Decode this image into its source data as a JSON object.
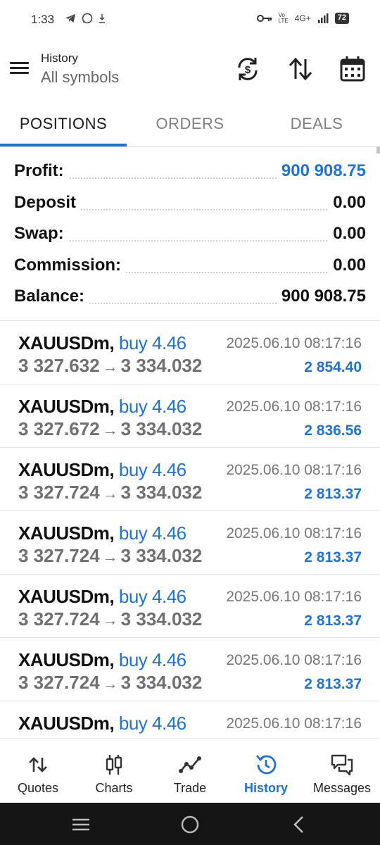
{
  "status": {
    "time": "1:33",
    "network": "4G+",
    "battery": "72"
  },
  "header": {
    "title": "History",
    "subtitle": "All symbols"
  },
  "tabs": [
    {
      "label": "POSITIONS",
      "active": true
    },
    {
      "label": "ORDERS",
      "active": false
    },
    {
      "label": "DEALS",
      "active": false
    }
  ],
  "summary": {
    "profit": {
      "label": "Profit:",
      "value": "900 908.75"
    },
    "deposit": {
      "label": "Deposit",
      "value": "0.00"
    },
    "swap": {
      "label": "Swap:",
      "value": "0.00"
    },
    "commission": {
      "label": "Commission:",
      "value": "0.00"
    },
    "balance": {
      "label": "Balance:",
      "value": "900 908.75"
    }
  },
  "deals": [
    {
      "symbol": "XAUUSDm,",
      "action": "buy 4.46",
      "time": "2025.06.10 08:17:16",
      "open": "3 327.632",
      "arrow": "→",
      "close": "3 334.032",
      "profit": "2 854.40"
    },
    {
      "symbol": "XAUUSDm,",
      "action": "buy 4.46",
      "time": "2025.06.10 08:17:16",
      "open": "3 327.672",
      "arrow": "→",
      "close": "3 334.032",
      "profit": "2 836.56"
    },
    {
      "symbol": "XAUUSDm,",
      "action": "buy 4.46",
      "time": "2025.06.10 08:17:16",
      "open": "3 327.724",
      "arrow": "→",
      "close": "3 334.032",
      "profit": "2 813.37"
    },
    {
      "symbol": "XAUUSDm,",
      "action": "buy 4.46",
      "time": "2025.06.10 08:17:16",
      "open": "3 327.724",
      "arrow": "→",
      "close": "3 334.032",
      "profit": "2 813.37"
    },
    {
      "symbol": "XAUUSDm,",
      "action": "buy 4.46",
      "time": "2025.06.10 08:17:16",
      "open": "3 327.724",
      "arrow": "→",
      "close": "3 334.032",
      "profit": "2 813.37"
    },
    {
      "symbol": "XAUUSDm,",
      "action": "buy 4.46",
      "time": "2025.06.10 08:17:16",
      "open": "3 327.724",
      "arrow": "→",
      "close": "3 334.032",
      "profit": "2 813.37"
    },
    {
      "symbol": "XAUUSDm,",
      "action": "buy 4.46",
      "time": "2025.06.10 08:17:16",
      "open": "",
      "arrow": "",
      "close": "",
      "profit": ""
    }
  ],
  "bottom_nav": [
    {
      "label": "Quotes",
      "icon": "quotes-icon",
      "active": false
    },
    {
      "label": "Charts",
      "icon": "charts-icon",
      "active": false
    },
    {
      "label": "Trade",
      "icon": "trade-icon",
      "active": false
    },
    {
      "label": "History",
      "icon": "history-icon",
      "active": true
    },
    {
      "label": "Messages",
      "icon": "messages-icon",
      "active": false
    }
  ],
  "colors": {
    "accent": "#1e74d6",
    "muted_text": "#777777",
    "system_nav": "#151515"
  }
}
